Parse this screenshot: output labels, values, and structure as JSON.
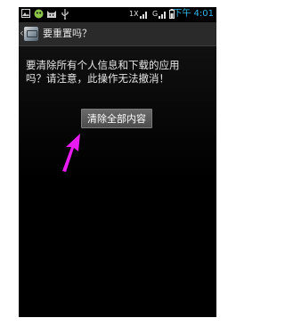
{
  "status_bar": {
    "signal_text": "1X",
    "network_text": "G",
    "clock": "下午 4:01",
    "icons": [
      "image-icon",
      "android-icon",
      "cat-icon",
      "usb-icon",
      "signal-icon",
      "battery-icon"
    ]
  },
  "action_bar": {
    "title": "要重置吗？",
    "icon": "settings-app-icon"
  },
  "content": {
    "message_line1": "要清除所有个人信息和下载的应用",
    "message_line2": "吗？请注意，此操作无法撤消！",
    "erase_button_label": "清除全部内容"
  },
  "annotation": {
    "arrow_color": "#e81cf0"
  }
}
